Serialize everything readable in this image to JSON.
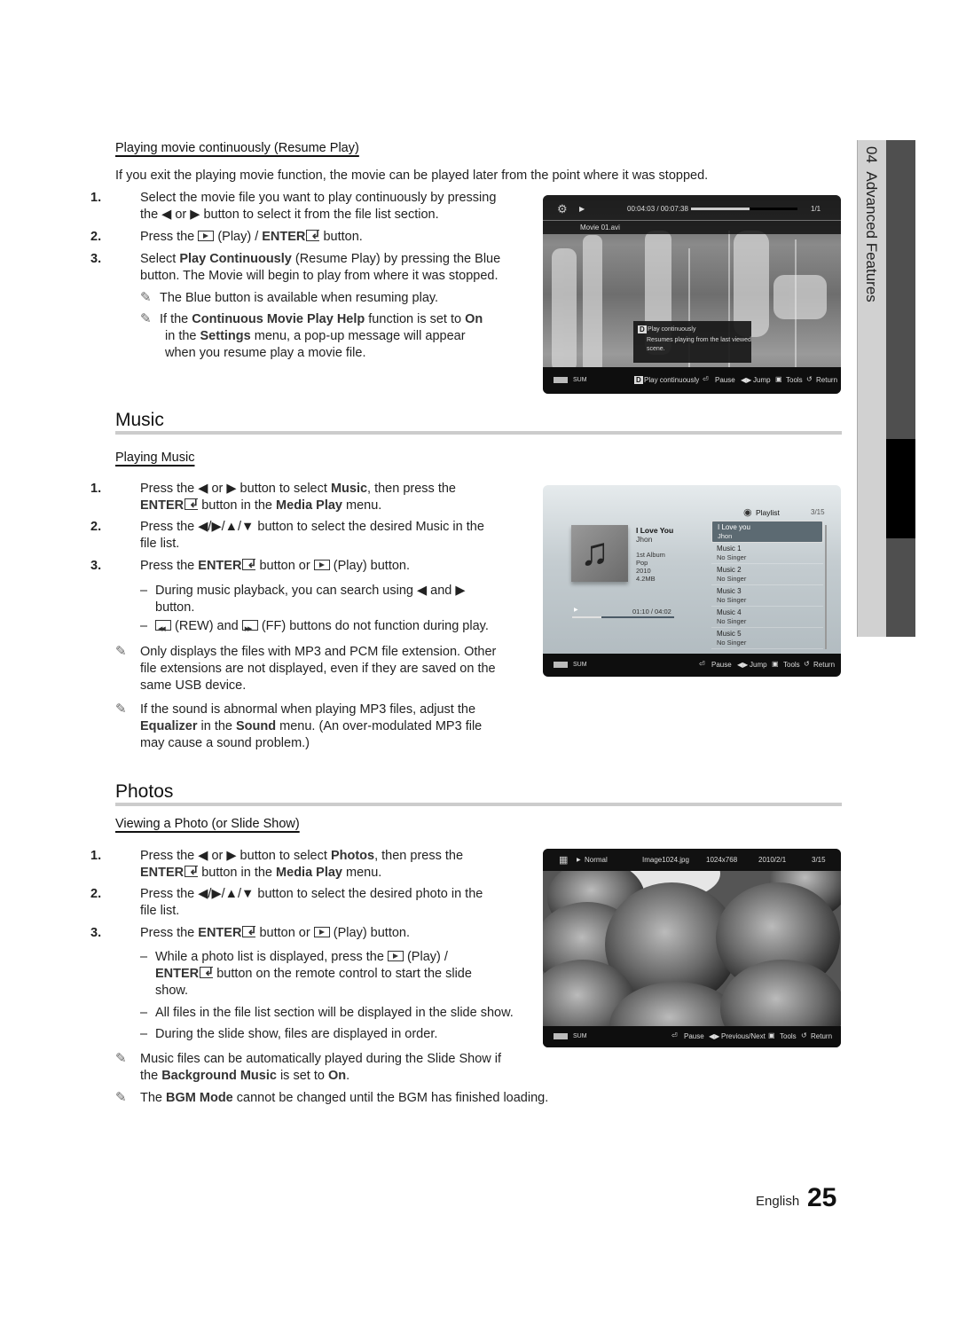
{
  "side_tab": {
    "chapter": "04",
    "title": "Advanced Features"
  },
  "resume": {
    "subheading": "Playing movie continuously (Resume Play)",
    "intro": "If you exit the playing movie function, the movie can be played later from the point where it was stopped.",
    "step1_num": "1.",
    "step1_line1": "Select the movie file you want to play continuously by pressing",
    "step1_line2": "the ◀ or ▶ button to select it from the file list section.",
    "step2_num": "2.",
    "step2_a": "Press the",
    "step2_b": "(Play) /",
    "step2_enter": "ENTER",
    "step2_c": "button.",
    "step3_num": "3.",
    "step3_a": "Select",
    "step3_bold": "Play Continuously",
    "step3_b": "(Resume Play) by pressing the Blue",
    "step3_line2": "button. The Movie will begin to play from where it was stopped.",
    "note1": "The Blue button is available when resuming play.",
    "note2_a": "If the",
    "note2_bold1": "Continuous Movie Play Help",
    "note2_b": "function is set to",
    "note2_bold2": "On",
    "note2_c": "in the",
    "note2_bold3": "Settings",
    "note2_d": "menu, a pop-up message will appear",
    "note2_line3": "when you resume play a movie file."
  },
  "movie_screen": {
    "time": "00:04:03 / 00:07:38",
    "count": "1/1",
    "filename": "Movie 01.avi",
    "progress_fraction": 0.55,
    "popup_key": "D",
    "popup_title": "Play continuously",
    "popup_body1": "Resumes playing from the last viewed",
    "popup_body2": "scene.",
    "device": "SUM",
    "footer": [
      {
        "key": "D",
        "label": "Play continuously"
      },
      {
        "icon": "enter-icon",
        "label": "Pause"
      },
      {
        "icon": "left-right-icon",
        "label": "Jump"
      },
      {
        "icon": "tools-icon",
        "label": "Tools"
      },
      {
        "icon": "return-icon",
        "label": "Return"
      }
    ]
  },
  "music": {
    "heading": "Music",
    "subheading": "Playing Music",
    "step1_num": "1.",
    "step1_a": "Press the ◀ or ▶ button to select",
    "step1_bold": "Music",
    "step1_b": ", then press the",
    "step1_enter": "ENTER",
    "step1_c": "button in the",
    "step1_bold2": "Media Play",
    "step1_d": "menu.",
    "step2_num": "2.",
    "step2_line1": "Press the ◀/▶/▲/▼ button to select the desired Music in the",
    "step2_line2": "file list.",
    "step3_num": "3.",
    "step3_a": "Press the",
    "step3_enter": "ENTER",
    "step3_b": "button or",
    "step3_c": "(Play) button.",
    "dash1_line1": "During music playback, you can search using ◀ and ▶",
    "dash1_line2": "button.",
    "dash2_a": "(REW) and",
    "dash2_b": "(FF) buttons do not function during play.",
    "note1_line1": "Only displays the files with MP3 and PCM file extension. Other",
    "note1_line2": "file extensions are not displayed, even if they are saved on the",
    "note1_line3": "same USB device.",
    "note2_line1": "If the sound is abnormal when playing MP3 files, adjust the",
    "note2_bold1": "Equalizer",
    "note2_a": "in the",
    "note2_bold2": "Sound",
    "note2_b": "menu. (An over-modulated MP3 file",
    "note2_line3": "may cause a sound problem.)"
  },
  "music_screen": {
    "playlist_label": "Playlist",
    "playlist_count": "3/15",
    "song_title": "I Love You",
    "artist": "Jhon",
    "album": "1st Album",
    "genre": "Pop",
    "year": "2010",
    "size": "4.2MB",
    "time": "01:10 / 04:02",
    "progress_fraction": 0.29,
    "playlist": [
      {
        "title": "I Love you",
        "artist": "Jhon",
        "selected": true
      },
      {
        "title": "Music 1",
        "artist": "No Singer"
      },
      {
        "title": "Music 2",
        "artist": "No Singer"
      },
      {
        "title": "Music 3",
        "artist": "No Singer"
      },
      {
        "title": "Music 4",
        "artist": "No Singer"
      },
      {
        "title": "Music 5",
        "artist": "No Singer"
      }
    ],
    "device": "SUM",
    "footer": [
      {
        "label": "Pause"
      },
      {
        "label": "Jump"
      },
      {
        "label": "Tools"
      },
      {
        "label": "Return"
      }
    ]
  },
  "photos": {
    "heading": "Photos",
    "subheading": "Viewing a Photo (or Slide Show)",
    "step1_num": "1.",
    "step1_a": "Press the ◀ or ▶ button to select",
    "step1_bold": "Photos",
    "step1_b": ", then press the",
    "step1_enter": "ENTER",
    "step1_c": "button in the",
    "step1_bold2": "Media Play",
    "step1_d": "menu.",
    "step2_num": "2.",
    "step2_line1": "Press the ◀/▶/▲/▼ button to select the desired photo in the",
    "step2_line2": "file list.",
    "step3_num": "3.",
    "step3_a": "Press the",
    "step3_enter": "ENTER",
    "step3_b": "button or",
    "step3_c": "(Play) button.",
    "dash1_a": "While a photo list is displayed, press the",
    "dash1_b": "(Play) /",
    "dash1_enter": "ENTER",
    "dash1_c": "button on the remote control to start the slide",
    "dash1_line3": "show.",
    "dash2": "All files in the file list section will be displayed in the slide show.",
    "dash3": "During the slide show, files are displayed in order.",
    "note1_line1": "Music files can be automatically played during the Slide Show if",
    "note1_a": "the",
    "note1_bold1": "Background Music",
    "note1_b": "is set to",
    "note1_bold2": "On",
    "note1_c": ".",
    "note2_a": "The",
    "note2_bold": "BGM Mode",
    "note2_b": "cannot be changed until the BGM has finished loading."
  },
  "photo_screen": {
    "mode": "Normal",
    "filename": "Image1024.jpg",
    "resolution": "1024x768",
    "date": "2010/2/1",
    "count": "3/15",
    "device": "SUM",
    "footer": [
      {
        "label": "Pause"
      },
      {
        "label": "Previous/Next"
      },
      {
        "label": "Tools"
      },
      {
        "label": "Return"
      }
    ]
  },
  "footer": {
    "language": "English",
    "page_number": "25"
  }
}
